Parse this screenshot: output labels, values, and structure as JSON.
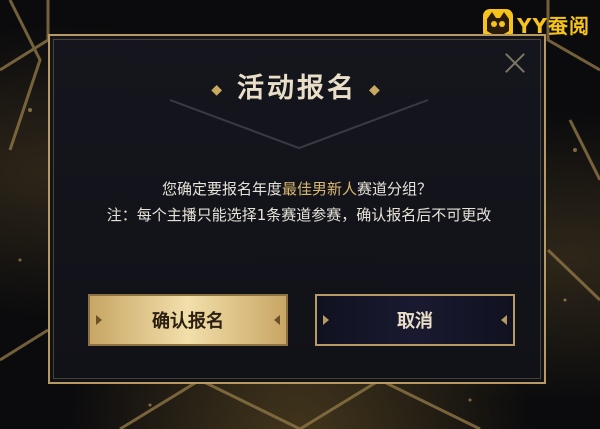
{
  "logo": {
    "text": "YY蚕阅"
  },
  "dialog": {
    "title": "活动报名",
    "question_prefix": "您确定要报名年度",
    "question_highlight": "最佳男新人",
    "question_suffix": "赛道分组？",
    "note": "注：每个主播只能选择1条赛道参赛，确认报名后不可更改",
    "confirm_label": "确认报名",
    "cancel_label": "取消"
  },
  "colors": {
    "accent_gold": "#b79a63",
    "highlight": "#d9b76d",
    "text": "#e6e2d8"
  }
}
